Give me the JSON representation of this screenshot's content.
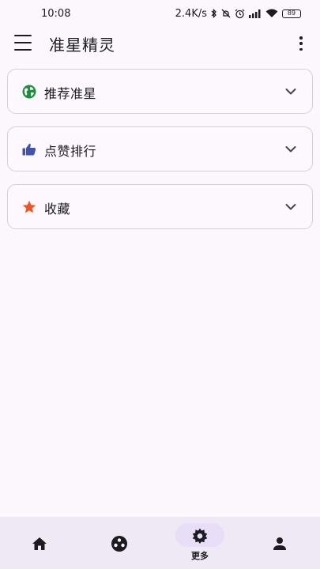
{
  "status_bar": {
    "time": "10:08",
    "network_speed": "2.4K/s",
    "battery_level": "89",
    "icons": [
      "bluetooth-icon",
      "mute-icon",
      "alarm-icon",
      "signal-icon",
      "wifi-icon",
      "battery-icon"
    ]
  },
  "app_bar": {
    "title": "准星精灵",
    "menu_icon": "menu-icon",
    "overflow_icon": "more-vert-icon"
  },
  "sections": [
    {
      "label": "推荐准星",
      "icon": "globe-icon",
      "icon_color": "#1e8e3e"
    },
    {
      "label": "点赞排行",
      "icon": "thumb-up-icon",
      "icon_color": "#3f51b5"
    },
    {
      "label": "收藏",
      "icon": "star-icon",
      "icon_color": "#f4511e"
    }
  ],
  "bottom_nav": {
    "items": [
      {
        "icon": "home-icon",
        "label": ""
      },
      {
        "icon": "gamepad-icon",
        "label": ""
      },
      {
        "icon": "settings-icon",
        "label": "更多",
        "selected": true
      },
      {
        "icon": "person-icon",
        "label": ""
      }
    ]
  },
  "colors": {
    "background": "#fcf7fd",
    "nav_background": "#efe8f5",
    "selected_pill": "#e8def8"
  }
}
